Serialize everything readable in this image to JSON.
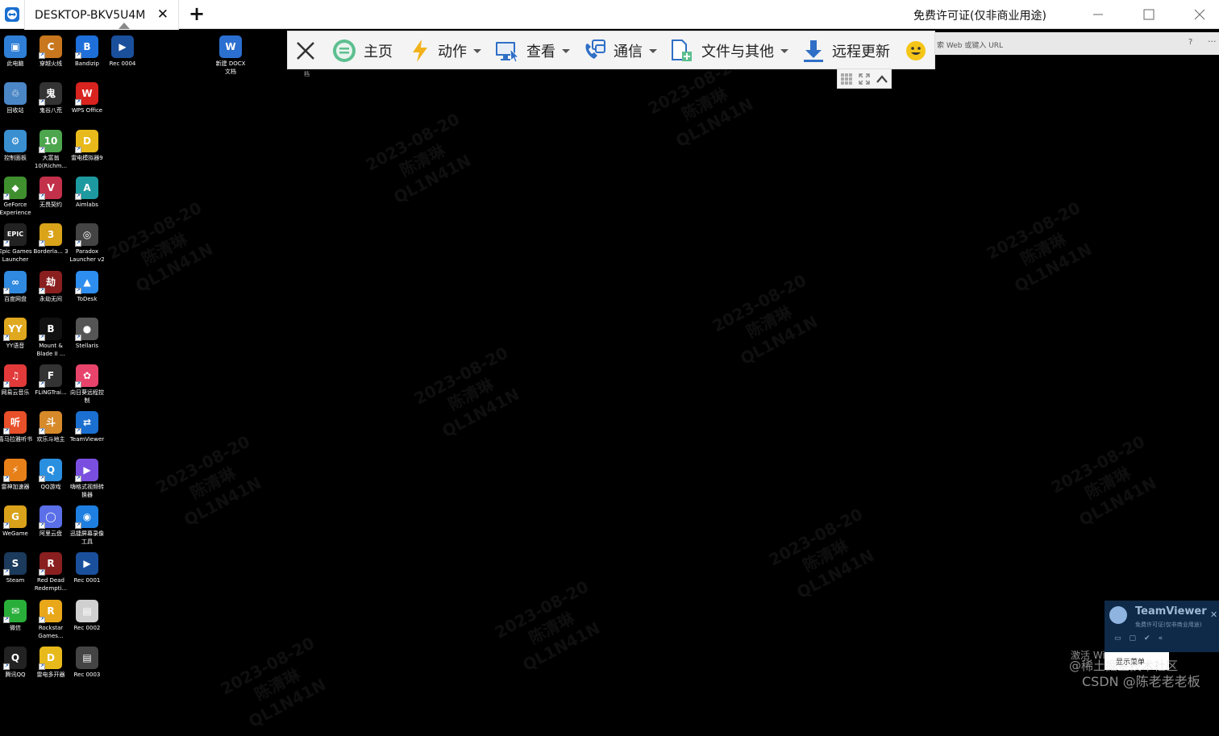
{
  "window": {
    "tab_title": "DESKTOP-BKV5U4M",
    "tab_close": "✕",
    "new_tab": "+",
    "license_text": "免费许可证(仅非商业用途)",
    "min_glyph": "—",
    "max_glyph": "☐",
    "close_glyph": "✕"
  },
  "browser": {
    "url_placeholder": "索 Web 或键入 URL",
    "help_glyph": "?",
    "more_glyph": "···"
  },
  "toolbar": {
    "close": "✕",
    "home": "主页",
    "action": "动作",
    "view": "查看",
    "communication": "通信",
    "files": "文件与其他",
    "remote_update": "远程更新",
    "stray_char": "档"
  },
  "desktop_icons": [
    {
      "label": "此电脑",
      "icon": "computer-icon",
      "color": "#2f7fd6",
      "glyph": "▣",
      "shortcut": false
    },
    {
      "label": "穿越火线",
      "icon": "crossfire-icon",
      "color": "#c8771e",
      "glyph": "C",
      "shortcut": true
    },
    {
      "label": "Bandizip",
      "icon": "bandizip-icon",
      "color": "#1e6fd9",
      "glyph": "B",
      "shortcut": true
    },
    {
      "label": "Rec 0004",
      "icon": "video-file-icon",
      "color": "#1a4f9c",
      "glyph": "▶",
      "shortcut": false
    },
    {
      "label": "新建 DOCX 文档",
      "icon": "docx-file-icon",
      "color": "#2b6fd0",
      "glyph": "W",
      "shortcut": false
    },
    {
      "label": "回收站",
      "icon": "recycle-bin-icon",
      "color": "#4b86c6",
      "glyph": "♲",
      "shortcut": false
    },
    {
      "label": "鬼谷八荒",
      "icon": "guigu-icon",
      "color": "#333333",
      "glyph": "鬼",
      "shortcut": true
    },
    {
      "label": "WPS Office",
      "icon": "wps-office-icon",
      "color": "#d8231f",
      "glyph": "W",
      "shortcut": true
    },
    {
      "label": "控制面板",
      "icon": "control-panel-icon",
      "color": "#3a8fd0",
      "glyph": "⚙",
      "shortcut": false
    },
    {
      "label": "大富翁10(Richm...",
      "icon": "richman-icon",
      "color": "#4da64d",
      "glyph": "10",
      "shortcut": true
    },
    {
      "label": "雷电模拟器9",
      "icon": "ldplayer-icon",
      "color": "#e8b91a",
      "glyph": "D",
      "shortcut": true
    },
    {
      "label": "GeForce Experience",
      "icon": "geforce-icon",
      "color": "#3f8f2f",
      "glyph": "◆",
      "shortcut": true
    },
    {
      "label": "无畏契约",
      "icon": "valorant-icon",
      "color": "#c2304a",
      "glyph": "V",
      "shortcut": true
    },
    {
      "label": "Aimlabs",
      "icon": "aimlabs-icon",
      "color": "#1d9aa0",
      "glyph": "A",
      "shortcut": true
    },
    {
      "label": "Epic Games Launcher",
      "icon": "epic-games-icon",
      "color": "#222222",
      "glyph": "EPIC",
      "shortcut": true
    },
    {
      "label": "Borderla... 3",
      "icon": "borderlands-icon",
      "color": "#d9a31a",
      "glyph": "3",
      "shortcut": true
    },
    {
      "label": "Paradox Launcher v2",
      "icon": "paradox-icon",
      "color": "#444444",
      "glyph": "◎",
      "shortcut": true
    },
    {
      "label": "百度网盘",
      "icon": "baidu-netdisk-icon",
      "color": "#2f8ae0",
      "glyph": "∞",
      "shortcut": true
    },
    {
      "label": "永劫无间",
      "icon": "naraka-icon",
      "color": "#8a1f1f",
      "glyph": "劫",
      "shortcut": true
    },
    {
      "label": "ToDesk",
      "icon": "todesk-icon",
      "color": "#2d8ef0",
      "glyph": "▲",
      "shortcut": true
    },
    {
      "label": "YY语音",
      "icon": "yy-icon",
      "color": "#e0a81e",
      "glyph": "YY",
      "shortcut": true
    },
    {
      "label": "Mount & Blade II ...",
      "icon": "bannerlord-icon",
      "color": "#111111",
      "glyph": "B",
      "shortcut": true
    },
    {
      "label": "Stellaris",
      "icon": "stellaris-icon",
      "color": "#555555",
      "glyph": "●",
      "shortcut": true
    },
    {
      "label": "网易云音乐",
      "icon": "netease-music-icon",
      "color": "#e23a3a",
      "glyph": "♫",
      "shortcut": true
    },
    {
      "label": "FLiNGTrai...",
      "icon": "flingtrainer-icon",
      "color": "#333333",
      "glyph": "F",
      "shortcut": true
    },
    {
      "label": "向日葵远程控制",
      "icon": "sunlogin-icon",
      "color": "#e8436b",
      "glyph": "✿",
      "shortcut": true
    },
    {
      "label": "喜马拉雅听书",
      "icon": "ximalaya-icon",
      "color": "#e8502a",
      "glyph": "听",
      "shortcut": true
    },
    {
      "label": "欢乐斗地主",
      "icon": "doudizhu-icon",
      "color": "#d68a2a",
      "glyph": "斗",
      "shortcut": true
    },
    {
      "label": "TeamViewer",
      "icon": "teamviewer-icon",
      "color": "#1b6fd0",
      "glyph": "⇄",
      "shortcut": true
    },
    {
      "label": "雷神加速器",
      "icon": "leishen-icon",
      "color": "#e8801a",
      "glyph": "⚡",
      "shortcut": true
    },
    {
      "label": "QQ游戏",
      "icon": "qq-game-icon",
      "color": "#2b8fe0",
      "glyph": "Q",
      "shortcut": true
    },
    {
      "label": "嗨格式视频转换器",
      "icon": "video-converter-icon",
      "color": "#7a4fe0",
      "glyph": "▶",
      "shortcut": true
    },
    {
      "label": "WeGame",
      "icon": "wegame-icon",
      "color": "#d9a21a",
      "glyph": "G",
      "shortcut": true
    },
    {
      "label": "阿里云盘",
      "icon": "aliyun-drive-icon",
      "color": "#5a6fe8",
      "glyph": "◯",
      "shortcut": true
    },
    {
      "label": "迅捷屏幕录像工具",
      "icon": "screen-recorder-icon",
      "color": "#1e7fe0",
      "glyph": "◉",
      "shortcut": true
    },
    {
      "label": "Steam",
      "icon": "steam-icon",
      "color": "#1b3a5c",
      "glyph": "S",
      "shortcut": true
    },
    {
      "label": "Red Dead Redempti...",
      "icon": "red-dead-icon",
      "color": "#8a1f1f",
      "glyph": "R",
      "shortcut": true
    },
    {
      "label": "Rec 0001",
      "icon": "video-file-icon",
      "color": "#1a4f9c",
      "glyph": "▶",
      "shortcut": false
    },
    {
      "label": "微信",
      "icon": "wechat-icon",
      "color": "#2aae3a",
      "glyph": "✉",
      "shortcut": true
    },
    {
      "label": "Rockstar Games...",
      "icon": "rockstar-icon",
      "color": "#e8a81a",
      "glyph": "R",
      "shortcut": true
    },
    {
      "label": "Rec 0002",
      "icon": "video-file-icon",
      "color": "#d0d0d0",
      "glyph": "▤",
      "shortcut": false
    },
    {
      "label": "腾讯QQ",
      "icon": "qq-icon",
      "color": "#222222",
      "glyph": "Q",
      "shortcut": true
    },
    {
      "label": "雷电多开器",
      "icon": "ldmultiplayer-icon",
      "color": "#e8b91a",
      "glyph": "D",
      "shortcut": true
    },
    {
      "label": "Rec 0003",
      "icon": "video-file-icon",
      "color": "#444444",
      "glyph": "▤",
      "shortcut": false
    }
  ],
  "watermark": {
    "date": "2023-08-20",
    "name": "陈清琳",
    "code": "QL1N41N"
  },
  "teamviewer_popup": {
    "title": "TeamViewer",
    "subtitle": "免费许可证(仅非商业用途)",
    "close": "✕",
    "menu_item": "显示菜单"
  },
  "overlay_text": {
    "activate": "激活 Wi",
    "community": "@稀土掘金技术社区",
    "csdn": "CSDN @陈老老老板"
  }
}
